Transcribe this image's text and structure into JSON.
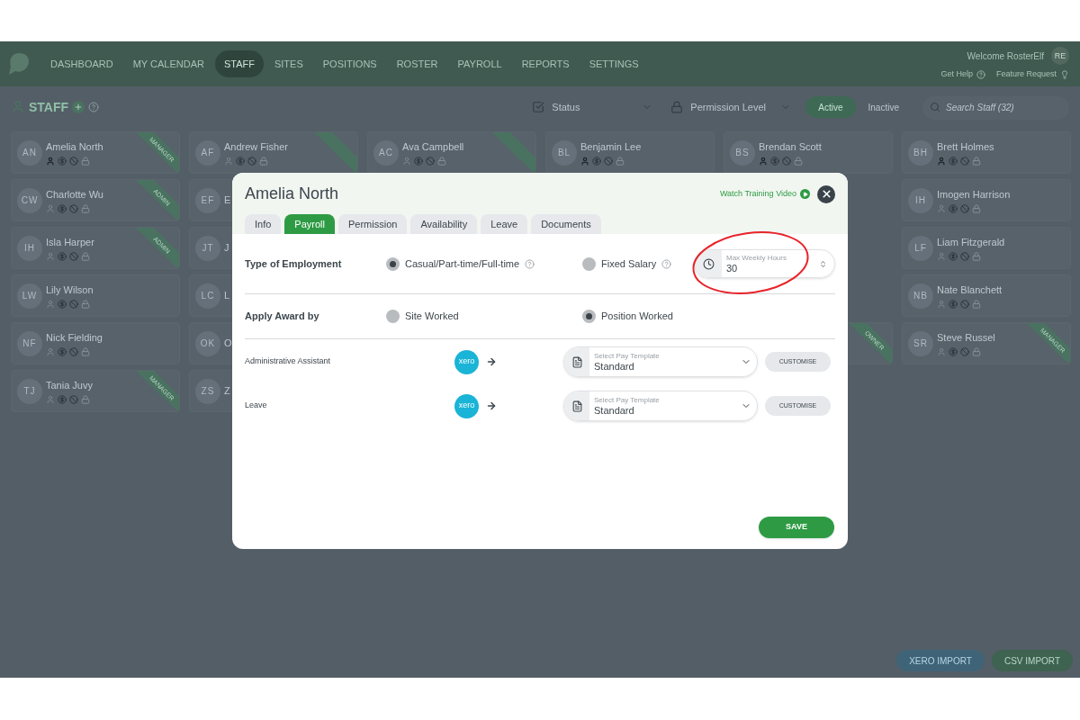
{
  "nav": {
    "items": [
      {
        "label": "DASHBOARD",
        "selected": false
      },
      {
        "label": "MY CALENDAR",
        "selected": false
      },
      {
        "label": "STAFF",
        "selected": true
      },
      {
        "label": "SITES",
        "selected": false
      },
      {
        "label": "POSITIONS",
        "selected": false
      },
      {
        "label": "ROSTER",
        "selected": false
      },
      {
        "label": "PAYROLL",
        "selected": false
      },
      {
        "label": "REPORTS",
        "selected": false
      },
      {
        "label": "SETTINGS",
        "selected": false
      }
    ],
    "welcome": "Welcome RosterElf",
    "avatar": "RE",
    "help_link": "Get Help",
    "request_link": "Feature Request"
  },
  "toolbar": {
    "title": "STAFF",
    "filters": [
      "Status",
      "Permission Level"
    ],
    "toggle": [
      {
        "label": "Active",
        "selected": true
      },
      {
        "label": "Inactive",
        "selected": false
      }
    ],
    "search": {
      "placeholder": "Search Staff (32)"
    }
  },
  "staff_columns": [
    {
      "cards": [
        {
          "initials": "AN",
          "name": "Amelia North",
          "person_active": true,
          "has_ribbon": true,
          "ribbon_label": "MANAGER"
        },
        {
          "initials": "CW",
          "name": "Charlotte Wu",
          "person_active": false,
          "has_ribbon": true,
          "ribbon_label": "ADMIN"
        },
        {
          "initials": "IH",
          "name": "Isla Harper",
          "person_active": false,
          "has_ribbon": true,
          "ribbon_label": "ADMIN"
        },
        {
          "initials": "LW",
          "name": "Lily Wilson",
          "person_active": false,
          "has_ribbon": false
        },
        {
          "initials": "NF",
          "name": "Nick Fielding",
          "person_active": false,
          "has_ribbon": false
        },
        {
          "initials": "TJ",
          "name": "Tania Juvy",
          "person_active": false,
          "has_ribbon": true,
          "ribbon_label": "MANAGER"
        }
      ]
    },
    {
      "cards": [
        {
          "initials": "AF",
          "name": "Andrew Fisher",
          "person_active": false,
          "has_ribbon": true
        },
        {
          "initials": "EF",
          "name": "E"
        },
        {
          "initials": "JT",
          "name": "J"
        },
        {
          "initials": "LC",
          "name": "L"
        },
        {
          "initials": "OK",
          "name": "O"
        },
        {
          "initials": "ZS",
          "name": "Z"
        }
      ]
    },
    {
      "cards": [
        {
          "initials": "AC",
          "name": "Ava Campbell",
          "person_active": false,
          "has_ribbon": true
        }
      ]
    },
    {
      "cards": [
        {
          "initials": "BL",
          "name": "Benjamin Lee",
          "person_active": true,
          "has_ribbon": false
        }
      ]
    },
    {
      "cards": [
        {
          "initials": "BS",
          "name": "Brendan Scott",
          "person_active": true,
          "has_ribbon": false
        },
        {
          "has_ribbon": true,
          "ribbon_label": "OWNER"
        }
      ]
    },
    {
      "cards": [
        {
          "initials": "BH",
          "name": "Brett Holmes",
          "person_active": true,
          "has_ribbon": false
        },
        {
          "initials": "IH",
          "name": "Imogen Harrison",
          "person_active": false,
          "has_ribbon": false
        },
        {
          "initials": "LF",
          "name": "Liam Fitzgerald",
          "person_active": false,
          "has_ribbon": false
        },
        {
          "initials": "NB",
          "name": "Nate Blanchett",
          "person_active": false,
          "has_ribbon": false
        },
        {
          "initials": "SR",
          "name": "Steve Russel",
          "person_active": false,
          "has_ribbon": true,
          "ribbon_label": "MANAGER"
        }
      ]
    }
  ],
  "import_buttons": [
    {
      "label": "XERO IMPORT",
      "kind": "xero"
    },
    {
      "label": "CSV IMPORT",
      "kind": "csv"
    }
  ],
  "modal": {
    "title": "Amelia North",
    "video_link": "Watch Training Video",
    "tabs": [
      {
        "label": "Info",
        "selected": false
      },
      {
        "label": "Payroll",
        "selected": true
      },
      {
        "label": "Permission",
        "selected": false
      },
      {
        "label": "Availability",
        "selected": false
      },
      {
        "label": "Leave",
        "selected": false
      },
      {
        "label": "Documents",
        "selected": false
      }
    ],
    "employment": {
      "label": "Type of Employment",
      "options": [
        {
          "label": "Casual/Part-time/Full-time",
          "selected": true,
          "has_help": true
        },
        {
          "label": "Fixed Salary",
          "selected": false,
          "has_help": true
        }
      ],
      "max_hours": {
        "label": "Max Weekly Hours",
        "value": "30"
      }
    },
    "award": {
      "label": "Apply Award by",
      "options": [
        {
          "label": "Site Worked",
          "selected": false
        },
        {
          "label": "Position Worked",
          "selected": true
        }
      ]
    },
    "pay_rows": [
      {
        "name": "Administrative Assistant",
        "logo": "xero",
        "select_label": "Select Pay Template",
        "value": "Standard",
        "button": "CUSTOMISE"
      },
      {
        "name": "Leave",
        "logo": "xero",
        "select_label": "Select Pay Template",
        "value": "Standard",
        "button": "CUSTOMISE"
      }
    ],
    "save": "SAVE"
  }
}
